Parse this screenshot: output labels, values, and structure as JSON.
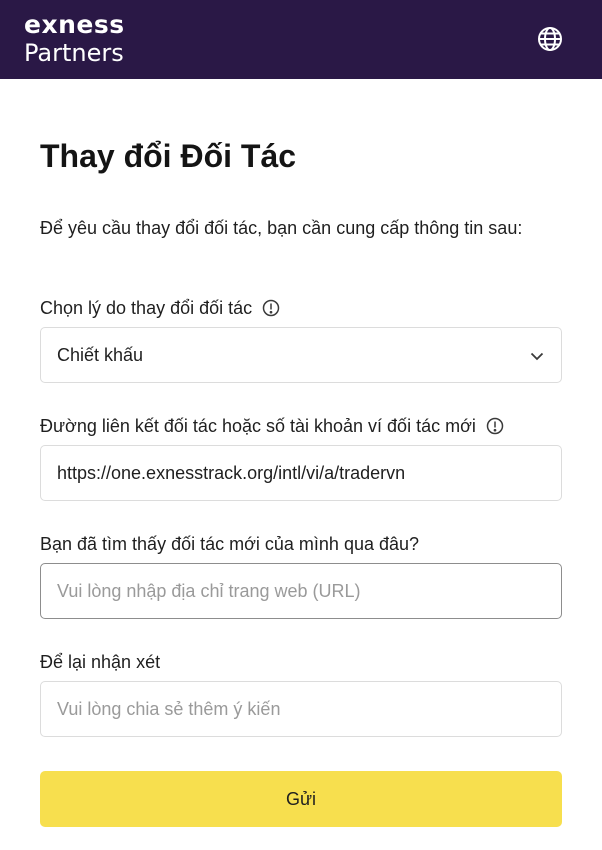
{
  "header": {
    "brand": "exness",
    "sub": "Partners",
    "language_icon": "globe-icon",
    "background": "#2a1846"
  },
  "page": {
    "title": "Thay đổi Đối Tác",
    "intro": "Để yêu cầu thay đổi đối tác, bạn cần cung cấp thông tin sau:"
  },
  "form": {
    "reason": {
      "label": "Chọn lý do thay đổi đối tác",
      "info_icon": "info-icon",
      "value": "Chiết khấu",
      "dropdown_icon": "chevron-down-icon"
    },
    "partner_link": {
      "label": "Đường liên kết đối tác hoặc số tài khoản ví đối tác mới",
      "info_icon": "info-icon",
      "value": "https://one.exnesstrack.org/intl/vi/a/tradervn"
    },
    "source": {
      "label": "Bạn đã tìm thấy đối tác mới của mình qua đâu?",
      "value": "",
      "placeholder": "Vui lòng nhập địa chỉ trang web (URL)"
    },
    "comment": {
      "label": "Để lại nhận xét",
      "value": "",
      "placeholder": "Vui lòng chia sẻ thêm ý kiến"
    },
    "submit_label": "Gửi",
    "submit_color": "#f7df4e"
  }
}
